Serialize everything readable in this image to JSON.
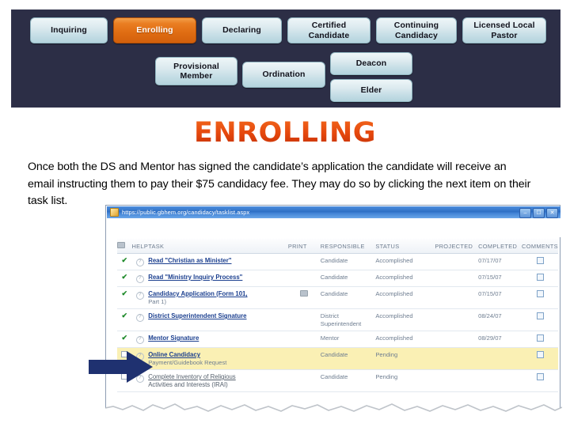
{
  "nav": {
    "row1": [
      {
        "label": "Inquiring",
        "active": false,
        "name": "nav-inquiring"
      },
      {
        "label": "Enrolling",
        "active": true,
        "name": "nav-enrolling"
      },
      {
        "label": "Declaring",
        "active": false,
        "name": "nav-declaring"
      },
      {
        "label": "Certified Candidate",
        "line1": "Certified",
        "line2": "Candidate",
        "active": false,
        "name": "nav-certified-candidate"
      },
      {
        "label": "Continuing Candidacy",
        "line1": "Continuing",
        "line2": "Candidacy",
        "active": false,
        "name": "nav-continuing-candidacy"
      },
      {
        "label": "Licensed Local Pastor",
        "line1": "Licensed Local",
        "line2": "Pastor",
        "active": false,
        "name": "nav-licensed-local-pastor"
      }
    ],
    "row2": [
      {
        "label": "Provisional Member",
        "line1": "Provisional",
        "line2": "Member",
        "name": "nav-provisional-member"
      },
      {
        "label": "Ordination",
        "name": "nav-ordination"
      },
      {
        "label": "Deacon",
        "name": "nav-deacon"
      },
      {
        "label": "Elder",
        "name": "nav-elder"
      }
    ],
    "accent_active": "#e0700f",
    "band_color": "#2c2e46",
    "button_color": "#d8eaf0"
  },
  "heading": {
    "text": "ENROLLING",
    "color": "#e5470d"
  },
  "body": {
    "paragraph": "Once both the DS and Mentor has signed the candidate’s application the candidate will receive an email instructing them to pay their $75 candidacy fee. They may do so by clicking the next item on their task list."
  },
  "browser": {
    "url": "https://public.gbhem.org/candidacy/tasklist.aspx",
    "window_controls": [
      "minimize",
      "maximize",
      "close"
    ],
    "table": {
      "headers": [
        "HELP",
        "TASK",
        "PRINT",
        "RESPONSIBLE",
        "STATUS",
        "PROJECTED",
        "COMPLETED",
        "COMMENTS"
      ],
      "rows": [
        {
          "done": true,
          "task": "Read \"Christian as Minister\"",
          "task_line2": "",
          "print": false,
          "responsible": "Candidate",
          "status": "Accomplished",
          "projected": "",
          "completed": "07/17/07",
          "comments": "checkbox",
          "highlight": false
        },
        {
          "done": true,
          "task": "Read \"Ministry Inquiry Process\"",
          "task_line2": "",
          "print": false,
          "responsible": "Candidate",
          "status": "Accomplished",
          "projected": "",
          "completed": "07/15/07",
          "comments": "checkbox",
          "highlight": false
        },
        {
          "done": true,
          "task": "Candidacy Application (Form 101,",
          "task_line2": "Part 1)",
          "print": true,
          "responsible": "Candidate",
          "status": "Accomplished",
          "projected": "",
          "completed": "07/15/07",
          "comments": "checkbox",
          "highlight": false
        },
        {
          "done": true,
          "task": "District Superintendent Signature",
          "task_line2": "",
          "print": false,
          "responsible": "District Superintendent",
          "status": "Accomplished",
          "projected": "",
          "completed": "08/24/07",
          "comments": "checkbox",
          "highlight": false
        },
        {
          "done": true,
          "task": "Mentor Signature",
          "task_line2": "",
          "print": false,
          "responsible": "Mentor",
          "status": "Accomplished",
          "projected": "",
          "completed": "08/29/07",
          "comments": "checkbox",
          "highlight": false
        },
        {
          "done": false,
          "task": "Online Candidacy",
          "task_line2": "Payment/Guidebook Request",
          "print": false,
          "responsible": "Candidate",
          "status": "Pending",
          "projected": "",
          "completed": "",
          "comments": "checkbox",
          "highlight": true
        },
        {
          "done": false,
          "task": "Complete Inventory of Religious",
          "task_line2": "Activities and Interests (IRAI)",
          "print": false,
          "responsible": "Candidate",
          "status": "Pending",
          "projected": "",
          "completed": "",
          "comments": "checkbox",
          "highlight": false
        }
      ]
    }
  },
  "pointer": {
    "name": "highlight-arrow",
    "color": "#1f3170",
    "direction": "right"
  }
}
